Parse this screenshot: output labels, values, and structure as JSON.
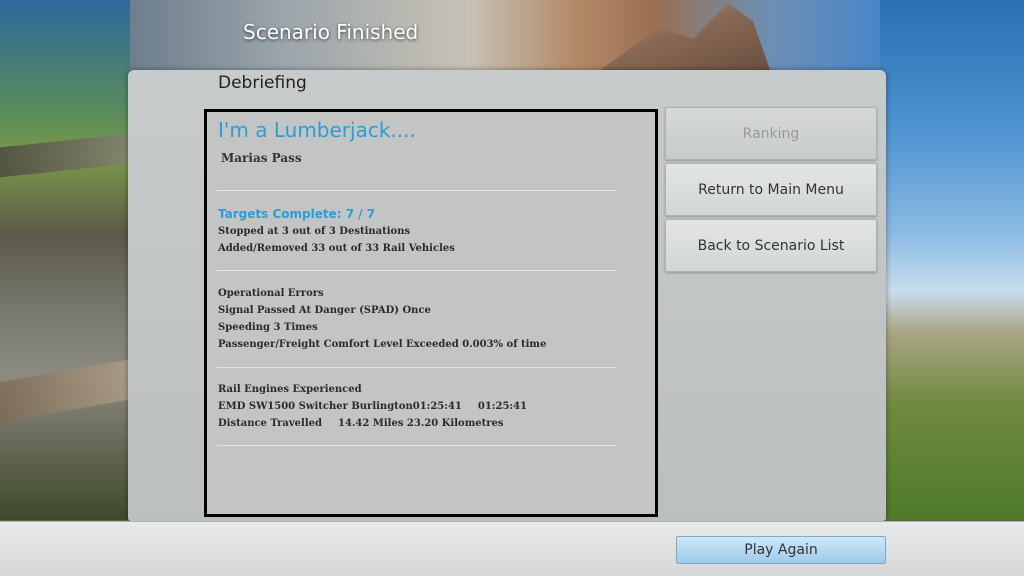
{
  "header": {
    "title": "Scenario Finished"
  },
  "panel": {
    "heading": "Debriefing"
  },
  "debrief": {
    "scenario_name": "I'm a Lumberjack....",
    "route": "Marias Pass",
    "targets": {
      "heading": "Targets Complete: 7 / 7",
      "lines": [
        "Stopped at 3 out of 3 Destinations",
        "Added/Removed 33 out of 33 Rail Vehicles"
      ]
    },
    "errors": {
      "heading": "Operational Errors",
      "lines": [
        "Signal Passed At Danger (SPAD) Once",
        "Speeding 3 Times",
        "Passenger/Freight Comfort Level Exceeded 0.003% of time"
      ]
    },
    "engines": {
      "heading": "Rail Engines Experienced",
      "engine_line": "EMD SW1500 Switcher Burlington01:25:41",
      "engine_time": "01:25:41",
      "distance_label": "Distance Travelled",
      "distance_value": "14.42 Miles 23.20 Kilometres"
    }
  },
  "buttons": {
    "ranking": "Ranking",
    "main_menu": "Return to Main Menu",
    "scenario_list": "Back to Scenario List",
    "play_again": "Play Again"
  }
}
